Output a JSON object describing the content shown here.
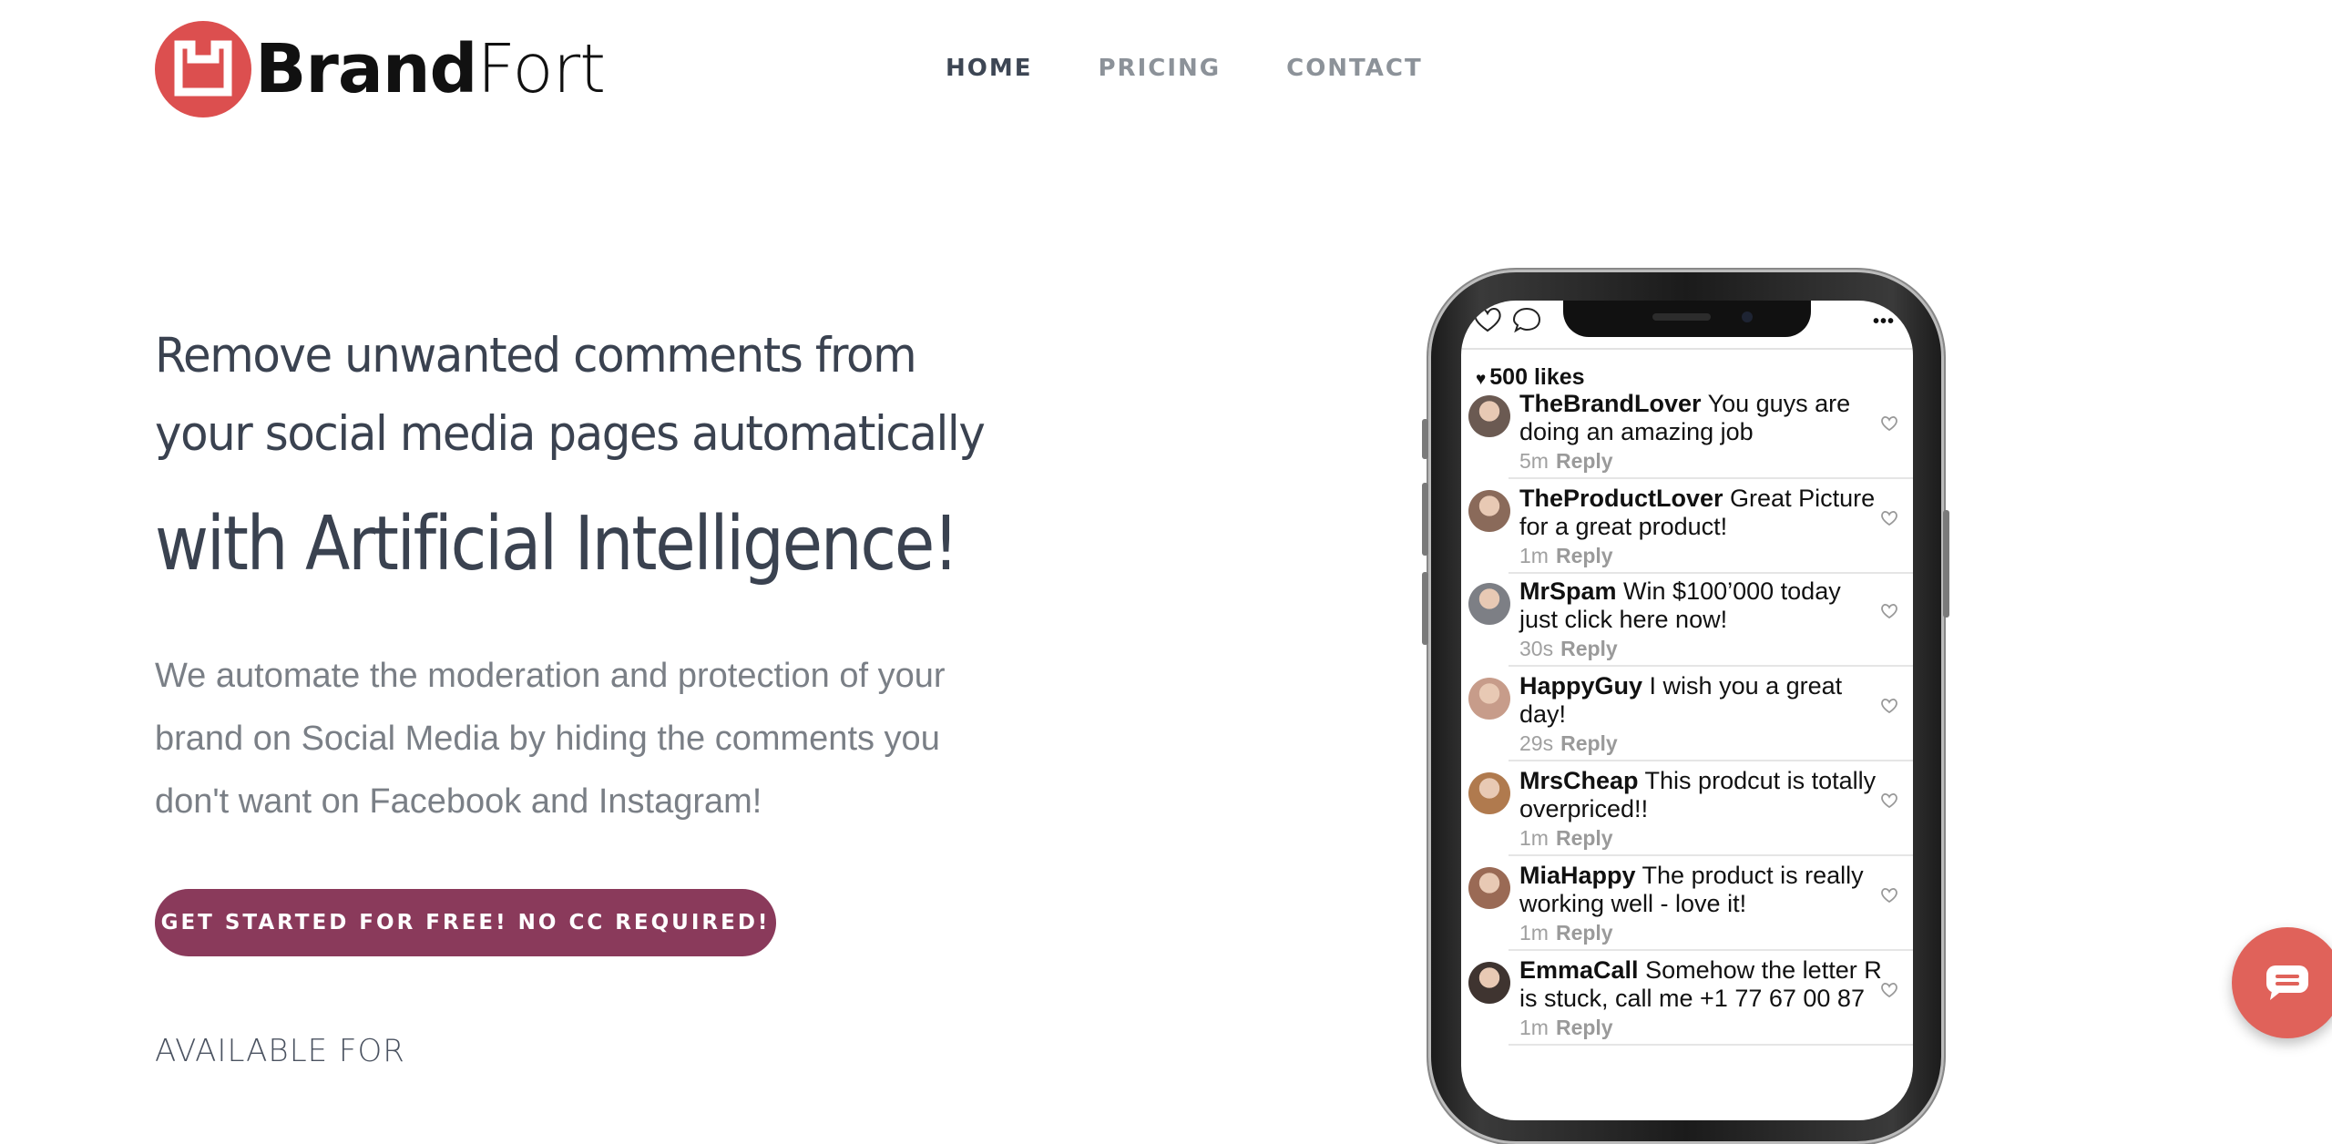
{
  "brand": {
    "name_bold": "Brand",
    "name_light": "Fort",
    "logo_color": "#dc4f4f"
  },
  "nav": [
    {
      "label": "HOME",
      "active": true
    },
    {
      "label": "PRICING",
      "active": false
    },
    {
      "label": "CONTACT",
      "active": false
    }
  ],
  "hero": {
    "line1": "Remove unwanted comments from",
    "line2": "your social media pages automatically",
    "line3": "with Artificial Intelligence!",
    "description": "We automate the moderation and protection of your brand on Social Media by hiding the comments you don't want on Facebook and Instagram!",
    "cta_label": "GET STARTED FOR FREE! NO CC REQUIRED!",
    "available_for": "AVAILABLE FOR"
  },
  "colors": {
    "cta": "#8a3a5b",
    "chat": "#e0625a",
    "text_dark": "#3a4250",
    "text_muted": "#7a7f86"
  },
  "phone": {
    "likes": "500  likes",
    "reply_label": "Reply",
    "comments": [
      {
        "user": "TheBrandLover",
        "text": "You guys are doing an amazing job",
        "time": "5m"
      },
      {
        "user": "TheProductLover",
        "text": "Great Picture for a great product!",
        "time": "1m"
      },
      {
        "user": "MrSpam",
        "text": "Win $100’000 today just click here now!",
        "time": "30s"
      },
      {
        "user": "HappyGuy",
        "text": "I wish you a great day!",
        "time": "29s"
      },
      {
        "user": "MrsCheap",
        "text": "This prodcut is totally overpriced!!",
        "time": "1m"
      },
      {
        "user": "MiaHappy",
        "text": "The product is really working well - love it!",
        "time": "1m"
      },
      {
        "user": "EmmaCall",
        "text": "Somehow the letter R is stuck, call me +1 77 67 00 87",
        "time": "1m"
      }
    ]
  },
  "icons": {
    "chat": "chat-bubble-icon",
    "like": "heart-outline-icon",
    "comment": "speech-bubble-icon",
    "more": "more-dots-icon"
  }
}
